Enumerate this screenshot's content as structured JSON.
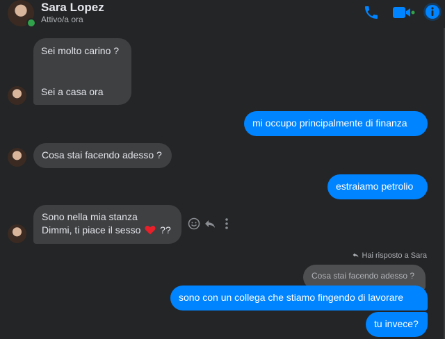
{
  "header": {
    "contact_name": "Sara Lopez",
    "contact_status": "Attivo/a ora",
    "accent_color": "#0084ff",
    "icons": [
      "phone-icon",
      "video-call-icon",
      "info-icon"
    ]
  },
  "messages": [
    {
      "from": "contact",
      "lines": [
        "Sei molto carino ?",
        "Sei a casa ora"
      ]
    },
    {
      "from": "me",
      "text": "mi occupo principalmente di finanza"
    },
    {
      "from": "contact",
      "text": "Cosa stai facendo adesso ?"
    },
    {
      "from": "me",
      "text": "estraiamo petrolio"
    },
    {
      "from": "contact",
      "lines": [
        "Sono nella mia stanza",
        "Dimmi, ti piace il sesso",
        "??"
      ],
      "emoji": "heart"
    },
    {
      "from": "me",
      "reply_note": "Hai risposto a Sara",
      "quoted": "Cosa stai facendo adesso ?",
      "text": "sono con un collega che stiamo fingendo di lavorare"
    },
    {
      "from": "me",
      "text": "tu invece?"
    }
  ]
}
